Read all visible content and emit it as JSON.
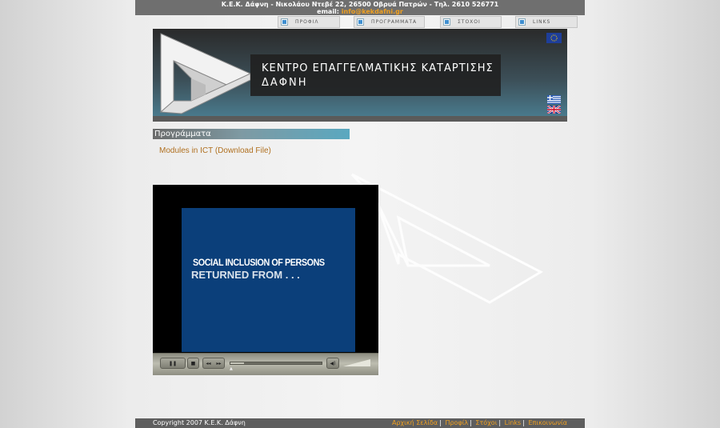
{
  "header": {
    "address_line": "Κ.Ε.Κ. Δάφνη - Νικολάου Ντεβέ 22, 26500 Οβρυά Πατρών - Τηλ. 2610 526771",
    "email_label": "email:",
    "email": "info@kekdafni.gr"
  },
  "nav": {
    "items": [
      {
        "label": "ΠΡΟΦΙΛ",
        "icon": "square-bullet-icon"
      },
      {
        "label": "ΠΡΟΓΡΑΜΜΑΤΑ",
        "icon": "square-bullet-icon"
      },
      {
        "label": "ΣΤΟΧΟΙ",
        "icon": "square-bullet-icon"
      },
      {
        "label": "LINKS",
        "icon": "square-bullet-icon"
      }
    ]
  },
  "banner": {
    "title_line1": "ΚΕΝΤΡΟ ΕΠΑΓΓΕΛΜΑΤΙΚΗΣ ΚΑΤΑΡΤΙΣΗΣ",
    "title_line2": "ΔΑΦΝΗ",
    "flags": [
      "eu-flag-icon",
      "greek-flag-icon",
      "uk-flag-icon"
    ]
  },
  "main": {
    "section_title": "Προγράμματα",
    "download_link": "Modules in ICT (Download File)"
  },
  "video": {
    "caption_line1": "SOCIAL INCLUSION OF PERSONS",
    "caption_line2": "RETURNED FROM . . .",
    "progress": 0.15,
    "controls": {
      "pause": "❚❚",
      "stop": "■",
      "rewind": "◂◂",
      "forward": "▸▸",
      "volume": "🔊"
    }
  },
  "footer": {
    "copyright": "Copyright 2007 Κ.Ε.Κ. Δάφνη",
    "links": [
      "Αρχική Σελίδα",
      "Προφίλ",
      "Στόχοι",
      "Links",
      "Επικοινωνία"
    ]
  },
  "colors": {
    "accent": "#f0a020",
    "link": "#b07020",
    "video_bg": "#0b3f7a",
    "bar": "#6f6f6f"
  }
}
